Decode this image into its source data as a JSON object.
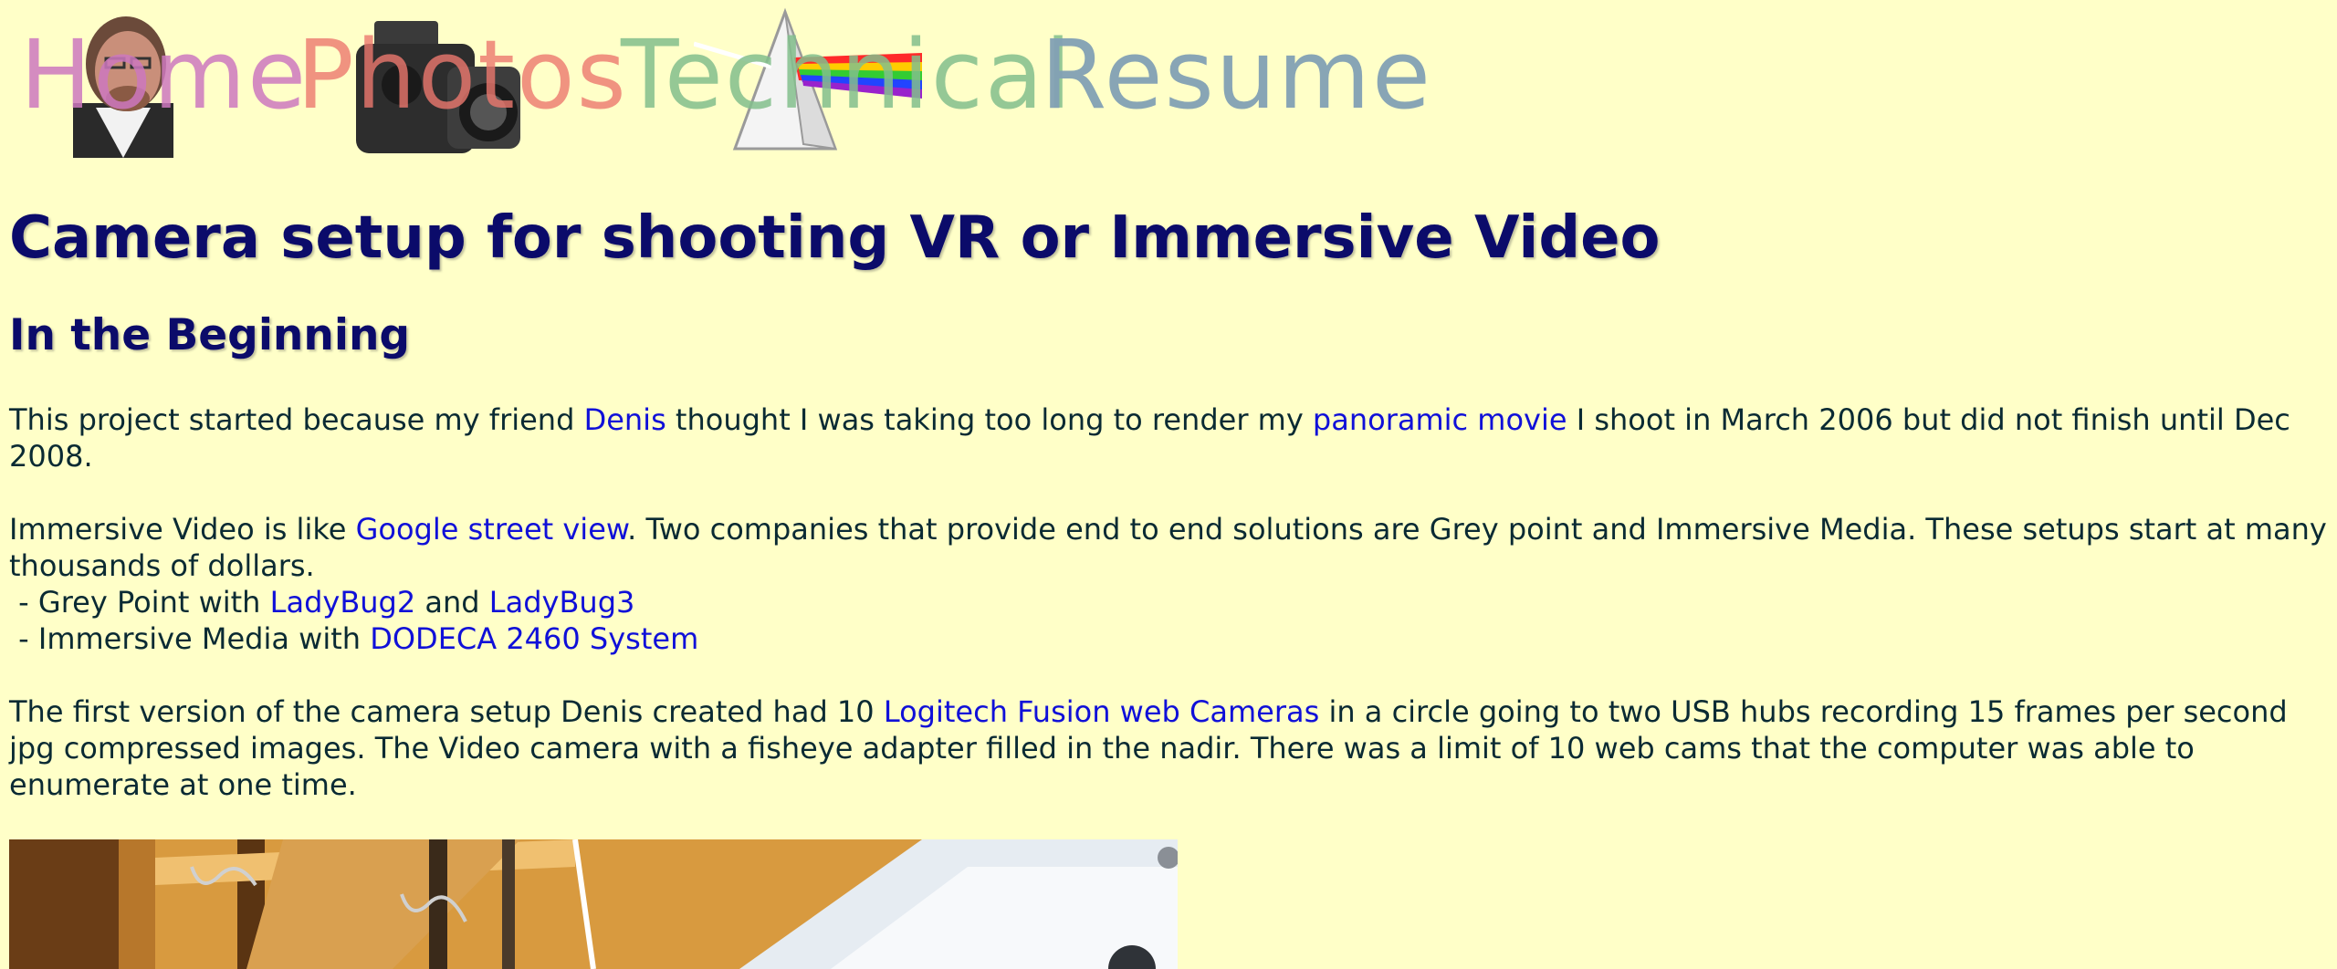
{
  "nav": {
    "home": "Home",
    "photos": "Photos",
    "technical": "Technical",
    "resume": "Resume"
  },
  "title": "Camera setup for shooting VR or Immersive Video",
  "section": "In the Beginning",
  "p1": {
    "t1": "This project started because my friend ",
    "link1": "Denis",
    "t2": " thought I was taking too long to render my ",
    "link2": "panoramic movie",
    "t3": " I shoot in March 2006 but did not finish until Dec 2008."
  },
  "p2": {
    "t1": "Immersive Video is like ",
    "link1": "Google street view",
    "t2": ".  Two companies that provide end to end solutions are Grey point and Immersive Media.  These setups start at many thousands of dollars.",
    "line1_prefix": " - Grey Point with ",
    "link_ladybug2": "LadyBug2",
    "and": " and ",
    "link_ladybug3": "LadyBug3",
    "line2_prefix": " - Immersive Media with ",
    "link_dodeca": "DODECA 2460 System"
  },
  "p3": {
    "t1": "The first version of the camera setup Denis created had 10 ",
    "link1": "Logitech Fusion web Cameras",
    "t2": " in a circle going to two USB hubs recording 15 frames per second jpg compressed images.  The Video camera with a fisheye adapter filled in the nadir.  There was a limit of 10 web cams that the computer was able to enumerate at one time."
  },
  "colors": {
    "background": "#ffffc8",
    "heading": "#0b0b6a",
    "link": "#1010d8",
    "text": "#0a2a33"
  }
}
